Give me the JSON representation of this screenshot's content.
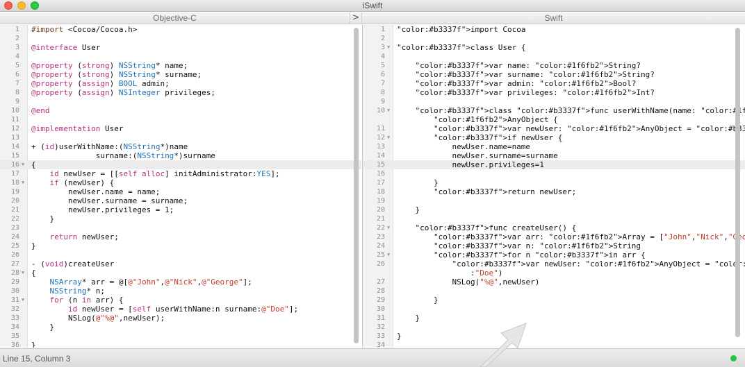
{
  "window": {
    "title": "iSwift"
  },
  "left_pane": {
    "header": "Objective-C",
    "lines": [
      {
        "n": "1",
        "fold": "",
        "code": "#import <Cocoa/Cocoa.h>"
      },
      {
        "n": "2",
        "fold": "",
        "code": ""
      },
      {
        "n": "3",
        "fold": "",
        "code": "@interface User"
      },
      {
        "n": "4",
        "fold": "",
        "code": ""
      },
      {
        "n": "5",
        "fold": "",
        "code": "@property (strong) NSString* name;"
      },
      {
        "n": "6",
        "fold": "",
        "code": "@property (strong) NSString* surname;"
      },
      {
        "n": "7",
        "fold": "",
        "code": "@property (assign) BOOL admin;"
      },
      {
        "n": "8",
        "fold": "",
        "code": "@property (assign) NSInteger privileges;"
      },
      {
        "n": "9",
        "fold": "",
        "code": ""
      },
      {
        "n": "10",
        "fold": "",
        "code": "@end"
      },
      {
        "n": "11",
        "fold": "",
        "code": ""
      },
      {
        "n": "12",
        "fold": "",
        "code": "@implementation User"
      },
      {
        "n": "13",
        "fold": "",
        "code": ""
      },
      {
        "n": "14",
        "fold": "",
        "code": "+ (id)userWithName:(NSString*)name"
      },
      {
        "n": "15",
        "fold": "",
        "code": "              surname:(NSString*)surname"
      },
      {
        "n": "16",
        "fold": "▼",
        "code": "{"
      },
      {
        "n": "17",
        "fold": "",
        "code": "    id newUser = [[self alloc] initAdministrator:YES];"
      },
      {
        "n": "18",
        "fold": "▼",
        "code": "    if (newUser) {"
      },
      {
        "n": "19",
        "fold": "",
        "code": "        newUser.name = name;"
      },
      {
        "n": "20",
        "fold": "",
        "code": "        newUser.surname = surname;"
      },
      {
        "n": "21",
        "fold": "",
        "code": "        newUser.privileges = 1;"
      },
      {
        "n": "22",
        "fold": "",
        "code": "    }"
      },
      {
        "n": "23",
        "fold": "",
        "code": ""
      },
      {
        "n": "24",
        "fold": "",
        "code": "    return newUser;"
      },
      {
        "n": "25",
        "fold": "",
        "code": "}"
      },
      {
        "n": "26",
        "fold": "",
        "code": ""
      },
      {
        "n": "27",
        "fold": "",
        "code": "- (void)createUser"
      },
      {
        "n": "28",
        "fold": "▼",
        "code": "{"
      },
      {
        "n": "29",
        "fold": "",
        "code": "    NSArray* arr = @[@\"John\",@\"Nick\",@\"George\"];"
      },
      {
        "n": "30",
        "fold": "",
        "code": "    NSString* n;"
      },
      {
        "n": "31",
        "fold": "▼",
        "code": "    for (n in arr) {"
      },
      {
        "n": "32",
        "fold": "",
        "code": "        id newUser = [self userWithName:n surname:@\"Doe\"];"
      },
      {
        "n": "33",
        "fold": "",
        "code": "        NSLog(@\"%@\",newUser);"
      },
      {
        "n": "34",
        "fold": "",
        "code": "    }"
      },
      {
        "n": "35",
        "fold": "",
        "code": ""
      },
      {
        "n": "36",
        "fold": "",
        "code": "}"
      }
    ]
  },
  "convert_button": {
    "label": ">"
  },
  "right_pane": {
    "header": "Swift",
    "lines": [
      {
        "n": "1",
        "fold": "",
        "code": "import Cocoa"
      },
      {
        "n": "2",
        "fold": "",
        "code": ""
      },
      {
        "n": "3",
        "fold": "▼",
        "code": "class User {"
      },
      {
        "n": "4",
        "fold": "",
        "code": ""
      },
      {
        "n": "5",
        "fold": "",
        "code": "    var name: String?"
      },
      {
        "n": "6",
        "fold": "",
        "code": "    var surname: String?"
      },
      {
        "n": "7",
        "fold": "",
        "code": "    var admin: Bool?"
      },
      {
        "n": "8",
        "fold": "",
        "code": "    var privileges: Int?"
      },
      {
        "n": "9",
        "fold": "",
        "code": ""
      },
      {
        "n": "10",
        "fold": "▼",
        "code": "    class func userWithName(name: String, surname surname: String) ->"
      },
      {
        "n": "",
        "fold": "",
        "code": "        AnyObject {"
      },
      {
        "n": "11",
        "fold": "",
        "code": "        var newUser: AnyObject = self.initAdministrator(true)"
      },
      {
        "n": "12",
        "fold": "▼",
        "code": "        if newUser {"
      },
      {
        "n": "13",
        "fold": "",
        "code": "            newUser.name=name"
      },
      {
        "n": "14",
        "fold": "",
        "code": "            newUser.surname=surname"
      },
      {
        "n": "15",
        "fold": "",
        "code": "            newUser.privileges=1"
      },
      {
        "n": "16",
        "fold": "",
        "code": ""
      },
      {
        "n": "17",
        "fold": "",
        "code": "        }"
      },
      {
        "n": "18",
        "fold": "",
        "code": "        return newUser;"
      },
      {
        "n": "19",
        "fold": "",
        "code": ""
      },
      {
        "n": "20",
        "fold": "",
        "code": "    }"
      },
      {
        "n": "21",
        "fold": "",
        "code": ""
      },
      {
        "n": "22",
        "fold": "▼",
        "code": "    func createUser() {"
      },
      {
        "n": "23",
        "fold": "",
        "code": "        var arr: Array = [\"John\",\"Nick\",\"George\"]"
      },
      {
        "n": "24",
        "fold": "",
        "code": "        var n: String"
      },
      {
        "n": "25",
        "fold": "▼",
        "code": "        for n in arr {"
      },
      {
        "n": "26",
        "fold": "",
        "code": "            var newUser: AnyObject = self.userWithName(n, surname"
      },
      {
        "n": "",
        "fold": "",
        "code": "                :\"Doe\")"
      },
      {
        "n": "27",
        "fold": "",
        "code": "            NSLog(\"%@\",newUser)"
      },
      {
        "n": "28",
        "fold": "",
        "code": ""
      },
      {
        "n": "29",
        "fold": "",
        "code": "        }"
      },
      {
        "n": "30",
        "fold": "",
        "code": ""
      },
      {
        "n": "31",
        "fold": "",
        "code": "    }"
      },
      {
        "n": "32",
        "fold": "",
        "code": ""
      },
      {
        "n": "33",
        "fold": "",
        "code": "}"
      },
      {
        "n": "34",
        "fold": "",
        "code": ""
      }
    ]
  },
  "status": {
    "cursor": "Line 15, Column 3",
    "indicator_color": "#21c443"
  },
  "colors": {
    "keyword": "#b3337f",
    "type": "#1f6fb2",
    "string": "#c33a2a",
    "number": "#3535d8",
    "preproc": "#6d3a1b"
  }
}
